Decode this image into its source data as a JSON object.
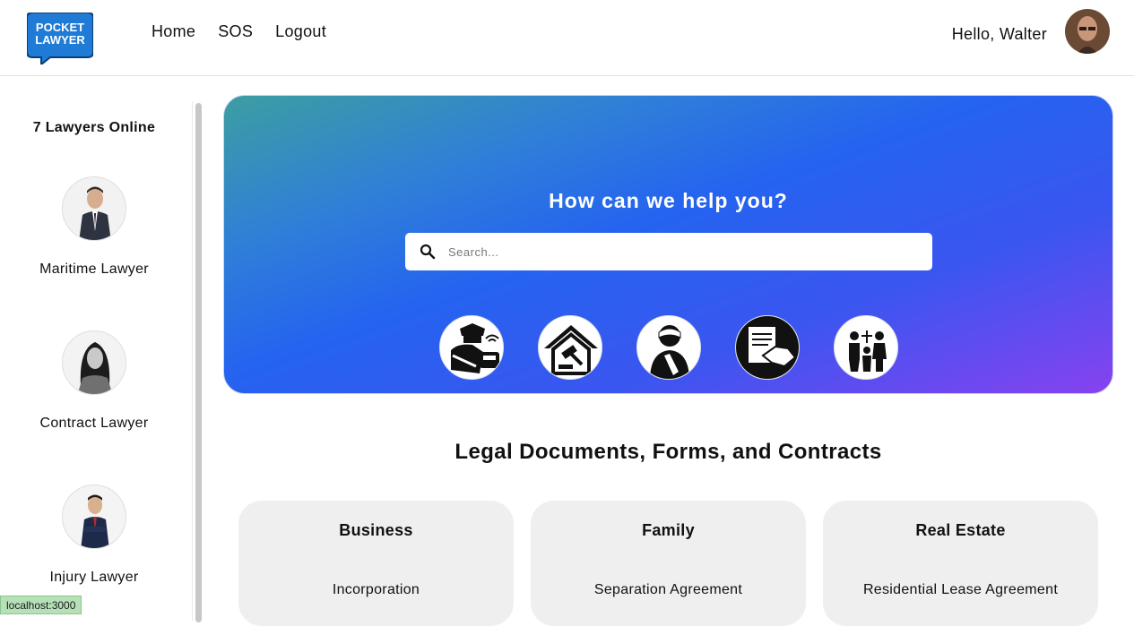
{
  "header": {
    "logo": {
      "line1": "POCKET",
      "line2": "LAWYER",
      "color": "#1f7bd6"
    },
    "nav": [
      "Home",
      "SOS",
      "Logout"
    ],
    "greeting": "Hello, Walter"
  },
  "sidebar": {
    "title": "7 Lawyers Online",
    "lawyers": [
      {
        "label": "Maritime Lawyer"
      },
      {
        "label": "Contract Lawyer"
      },
      {
        "label": "Injury Lawyer"
      }
    ]
  },
  "status_url": "localhost:3000",
  "hero": {
    "title": "How can we help you?",
    "search_placeholder": "Search...",
    "categories": [
      "police-car-icon",
      "house-gavel-icon",
      "injured-person-icon",
      "contract-handshake-icon",
      "family-scales-icon"
    ]
  },
  "documents": {
    "title": "Legal Documents, Forms, and Contracts",
    "cards": [
      {
        "title": "Business",
        "item": "Incorporation"
      },
      {
        "title": "Family",
        "item": "Separation Agreement"
      },
      {
        "title": "Real Estate",
        "item": "Residential Lease Agreement"
      }
    ]
  }
}
